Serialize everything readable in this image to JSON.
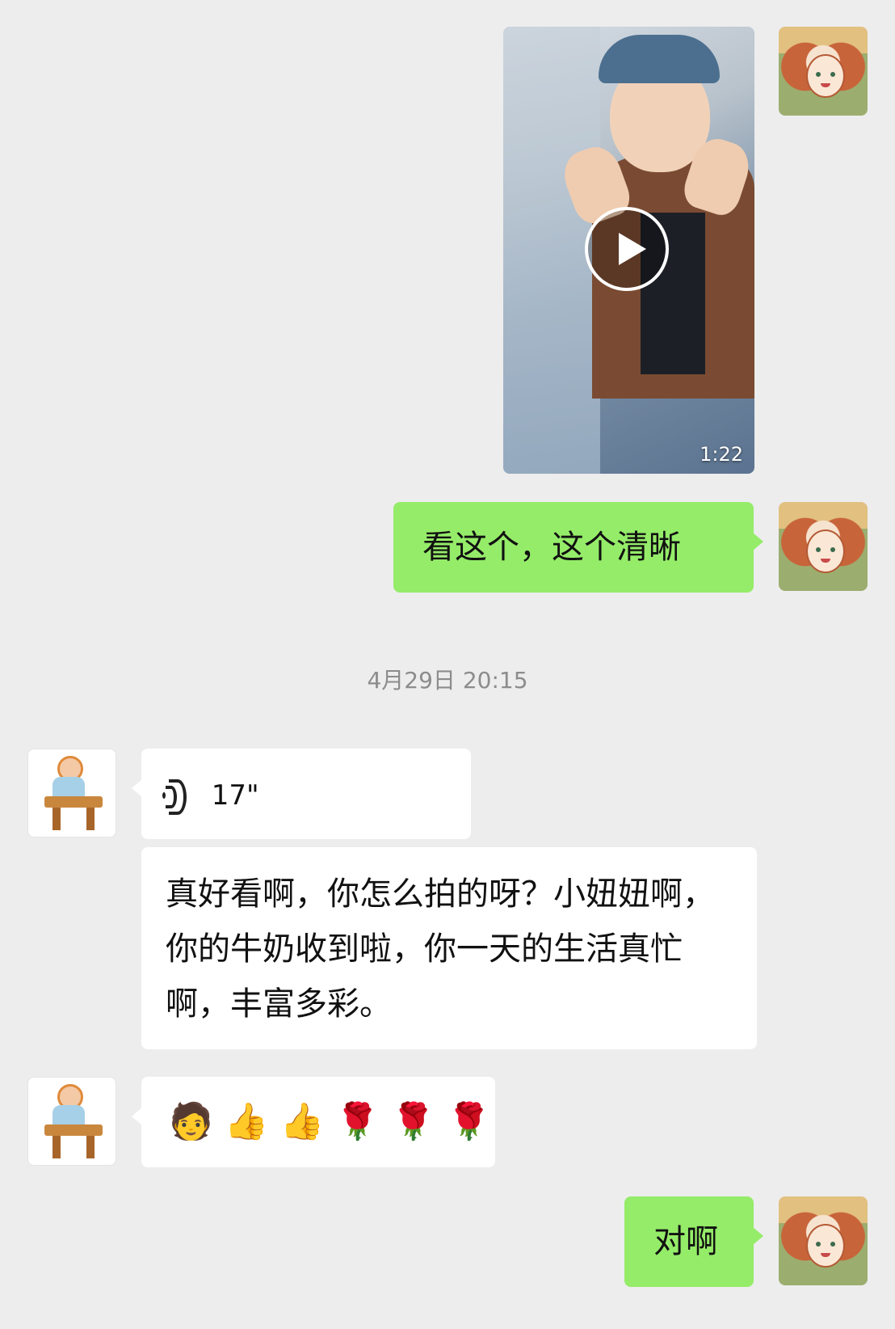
{
  "messages": {
    "video": {
      "duration": "1:22"
    },
    "green_1": {
      "text": "看这个，这个清晰"
    },
    "timestamp": "4月29日 20:15",
    "voice": {
      "duration": "17\""
    },
    "white_text": {
      "text": "真好看啊，你怎么拍的呀？小妞妞啊，你的牛奶收到啦，你一天的生活真忙啊，丰富多彩。"
    },
    "emoji_row": [
      "🧑",
      "👍",
      "👍",
      "🌹",
      "🌹",
      "🌹"
    ],
    "green_2": {
      "text": "对啊"
    }
  },
  "colors": {
    "green_bubble": "#95ec69",
    "background": "#ededed",
    "white_bubble": "#ffffff"
  }
}
